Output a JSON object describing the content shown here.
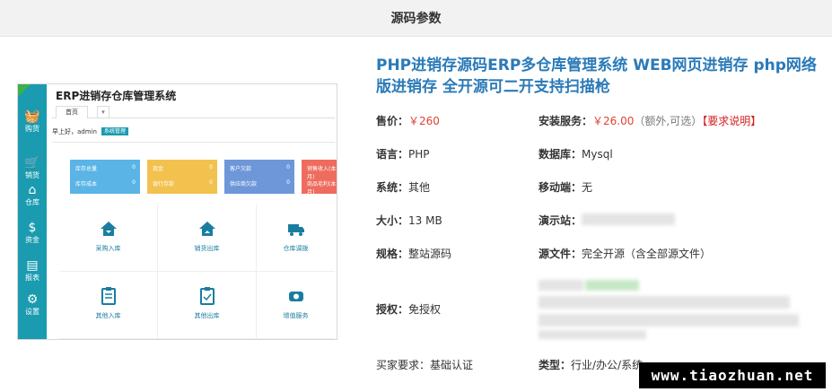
{
  "header": {
    "title": "源码参数"
  },
  "preview": {
    "app_title": "ERP进销存仓库管理系统",
    "tab": "首页",
    "tab_dropdown": "▾",
    "greeting": "早上好，admin",
    "badge": "系统管理",
    "nav": [
      {
        "label": "购货",
        "icon": "basket-icon"
      },
      {
        "label": "销货",
        "icon": "cart-icon"
      },
      {
        "label": "仓库",
        "icon": "warehouse-icon"
      },
      {
        "label": "资金",
        "icon": "money-icon"
      },
      {
        "label": "报表",
        "icon": "report-icon"
      },
      {
        "label": "设置",
        "icon": "gear-icon"
      }
    ],
    "cards": [
      {
        "a": "库存总量",
        "b": "库存成本",
        "n1": "0",
        "n2": "0",
        "color": "#5ab4e6"
      },
      {
        "a": "现金",
        "b": "银行存款",
        "n1": "0",
        "n2": "0",
        "color": "#f3c14e"
      },
      {
        "a": "客户欠款",
        "b": "供应商欠款",
        "n1": "0",
        "n2": "0",
        "color": "#6e97d9"
      },
      {
        "a": "销售收入(本月)",
        "b": "商品毛利(本月)",
        "n1": "",
        "n2": "",
        "color": "#ee6c5e"
      }
    ],
    "grid": [
      {
        "label": "采购入库",
        "icon": "house-in-icon"
      },
      {
        "label": "销货出库",
        "icon": "house-out-icon"
      },
      {
        "label": "仓库调拨",
        "icon": "truck-icon"
      },
      {
        "label": "其他入库",
        "icon": "clipboard-in-icon"
      },
      {
        "label": "其他出库",
        "icon": "clipboard-out-icon"
      },
      {
        "label": "增值服务",
        "icon": "service-icon"
      }
    ]
  },
  "product": {
    "title": "PHP进销存源码ERP多仓库管理系统 WEB网页进销存 php网络版进销存 全开源可二开支持扫描枪",
    "price_label": "售价：",
    "price": "￥260",
    "install_label": "安装服务：",
    "install_price": "￥26.00",
    "install_note": "（额外,可选）",
    "install_link": "【要求说明】",
    "language_label": "语言：",
    "language": "PHP",
    "db_label": "数据库：",
    "db": "Mysql",
    "system_label": "系统：",
    "system": "其他",
    "mobile_label": "移动端：",
    "mobile": "无",
    "size_label": "大小：",
    "size": "13 MB",
    "demo_label": "演示站：",
    "spec_label": "规格：",
    "spec": "整站源码",
    "files_label": "源文件：",
    "files": "完全开源（含全部源文件）",
    "license_label": "授权：",
    "license": "免授权",
    "buyer_label": "买家要求：",
    "buyer": "基础认证",
    "type_label": "类型：",
    "type": "行业/办公/系统"
  },
  "watermark": "www.tiaozhuan.net"
}
